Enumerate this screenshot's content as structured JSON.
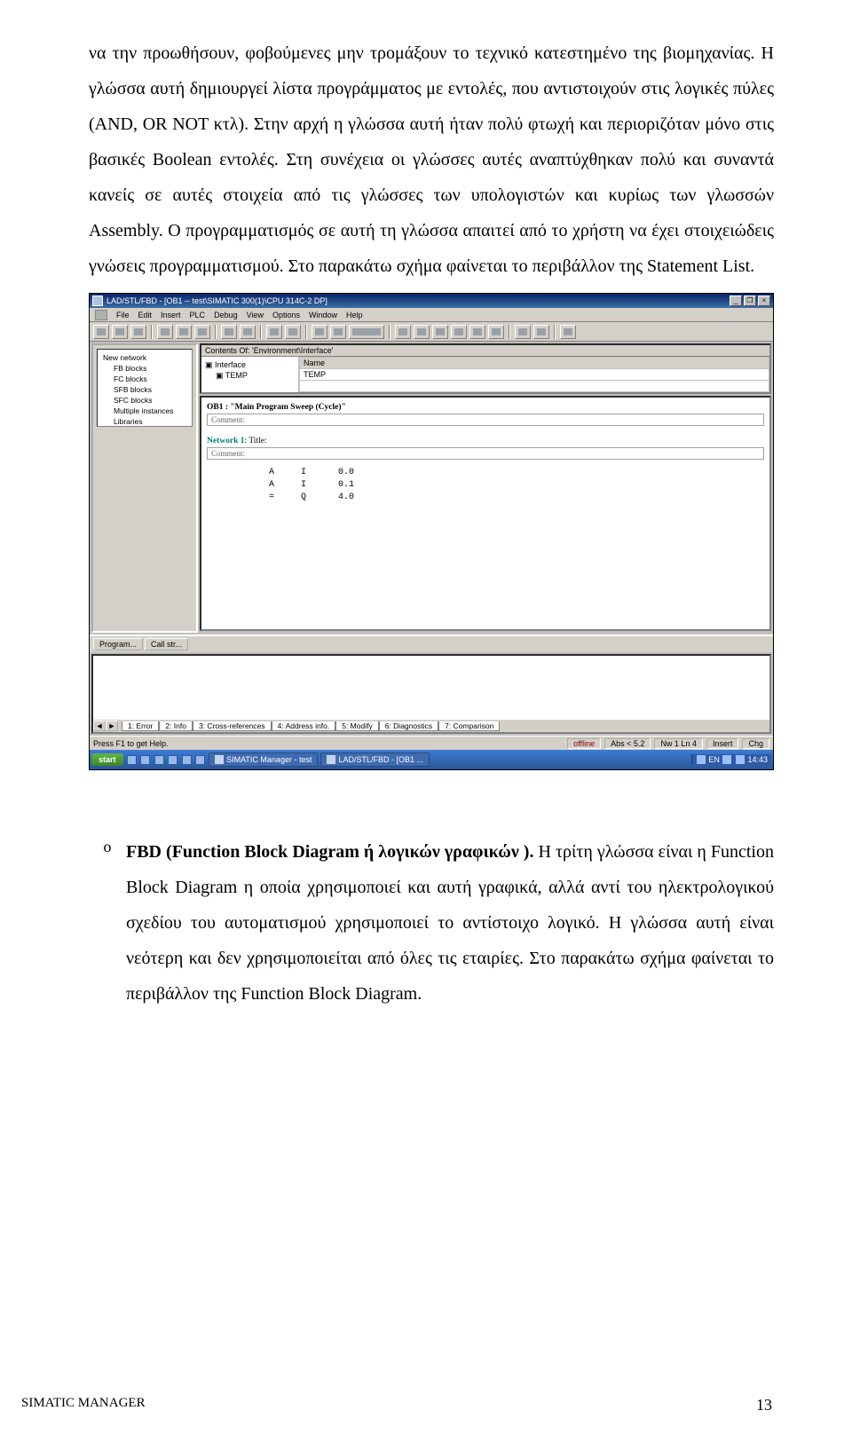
{
  "article": {
    "p1": "να την προωθήσουν, φοβούμενες μην τρομάξουν το τεχνικό κατεστημένο της βιομηχανίας. Η γλώσσα αυτή δημιουργεί λίστα προγράμματος με εντολές, που αντιστοιχούν στις λογικές πύλες (AND, OR NOT κτλ). Στην αρχή η γλώσσα αυτή ήταν πολύ φτωχή και περιοριζόταν μόνο στις βασικές Boolean εντολές. Στη συνέχεια οι γλώσσες αυτές αναπτύχθηκαν πολύ και συναντά κανείς σε αυτές στοιχεία από τις γλώσσες των υπολογιστών και κυρίως των γλωσσών Assembly. Ο προγραμματισμός σε αυτή τη γλώσσα απαιτεί από το χρήστη να έχει στοιχειώδεις γνώσεις προγραμματισμού. Στο παρακάτω σχήμα φαίνεται το περιβάλλον της Statement List.",
    "list_marker": "o",
    "fbd_bold": "FBD (Function Block Diagram ή λογικών γραφικών ).",
    "p2": " Η τρίτη γλώσσα είναι η Function Block Diagram η οποία χρησιμοποιεί και αυτή γραφικά, αλλά αντί του ηλεκτρολογικού σχεδίου του αυτοματισμού χρησιμοποιεί το αντίστοιχο λογικό. Η γλώσσα αυτή είναι νεότερη και δεν χρησιμοποιείται από όλες τις εταιρίες. Στο παρακάτω σχήμα φαίνεται το περιβάλλον της Function Block Diagram."
  },
  "app": {
    "title": "LAD/STL/FBD - [OB1 -- test\\SIMATIC 300(1)\\CPU 314C-2 DP]",
    "menus": [
      "File",
      "Edit",
      "Insert",
      "PLC",
      "Debug",
      "View",
      "Options",
      "Window",
      "Help"
    ],
    "tree": {
      "root": "New network",
      "nodes": [
        "FB blocks",
        "FC blocks",
        "SFB blocks",
        "SFC blocks",
        "Multiple instances",
        "Libraries"
      ]
    },
    "contents_hdr": "Contents Of: 'Environment\\Interface'",
    "iface": {
      "left_label": "Interface",
      "left_sub": "TEMP",
      "col_name": "Name",
      "row_val": "TEMP"
    },
    "code": {
      "ob_line": "OB1 : \"Main Program Sweep (Cycle)\"",
      "comment_lbl": "Comment:",
      "network_lbl": "Network 1",
      "title_suffix": ": Title:",
      "stl": "A     I      0.0\nA     I      0.1\n=     Q      4.0"
    },
    "left_tabs": [
      "Program...",
      "Call str..."
    ],
    "bottom_tabs": [
      "1: Error",
      "2: Info",
      "3: Cross-references",
      "4: Address info.",
      "5: Modify",
      "6: Diagnostics",
      "7: Comparison"
    ],
    "status": {
      "left": "Press F1 to get Help.",
      "conn": "offline",
      "abs": "Abs < 5.2",
      "pos": "Nw 1  Ln 4",
      "ins": "Insert",
      "chg": "Chg"
    },
    "taskbar": {
      "start": "start",
      "items": [
        "SIMATIC Manager - test",
        "LAD/STL/FBD - [OB1 ..."
      ],
      "lang": "EN",
      "clock": "14:43"
    }
  },
  "footer": {
    "left": "SIMATIC MANAGER",
    "page": "13"
  }
}
